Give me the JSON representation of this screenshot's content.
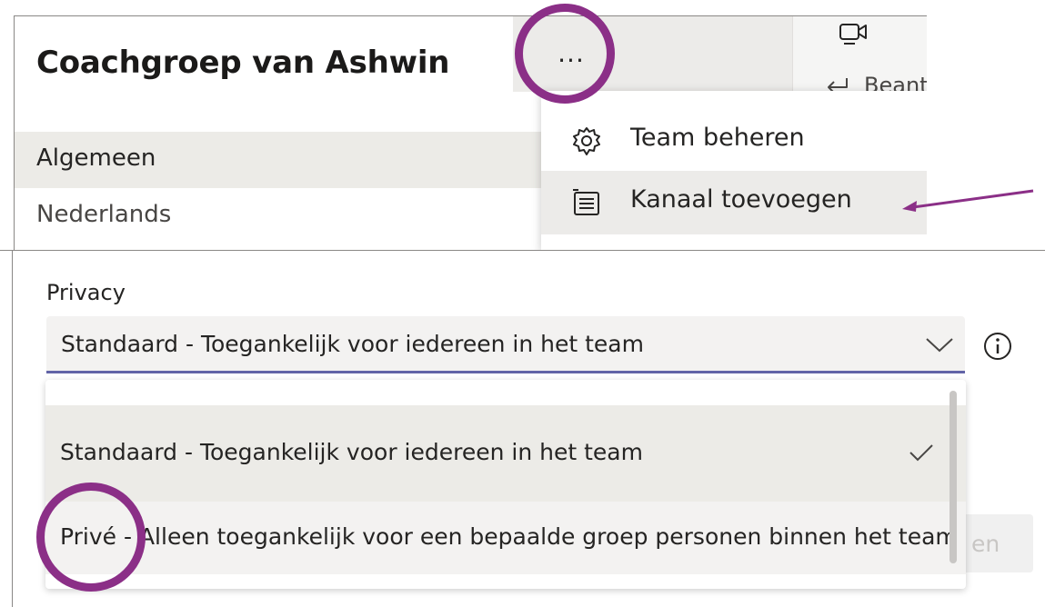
{
  "team": {
    "title": "Coachgroep van Ashwin",
    "channels": [
      {
        "label": "Algemeen"
      },
      {
        "label": "Nederlands"
      }
    ],
    "more_label": "..."
  },
  "context": {
    "reply_label": "Beant"
  },
  "menu": {
    "items": [
      {
        "label": "Team beheren",
        "icon": "gear-icon"
      },
      {
        "label": "Kanaal toevoegen",
        "icon": "channel-add-icon"
      }
    ]
  },
  "privacy": {
    "label": "Privacy",
    "selected": "Standaard - Toegankelijk voor iedereen in het team",
    "options": [
      {
        "label": "Standaard - Toegankelijk voor iedereen in het team",
        "checked": true
      },
      {
        "label": "Privé - Alleen toegankelijk voor een bepaalde groep personen binnen het team",
        "checked": false
      }
    ],
    "ghost_button_label": "en"
  },
  "colors": {
    "accent": "#6264a7",
    "annotation": "#8b2f87",
    "selected_bg": "#ecebe7"
  }
}
